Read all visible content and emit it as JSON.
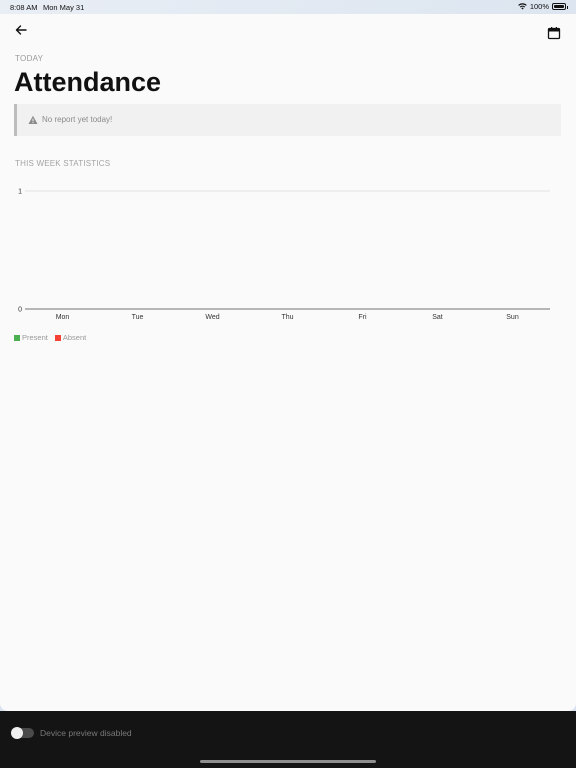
{
  "status_bar": {
    "time": "8:08 AM",
    "date": "Mon May 31",
    "battery": "100%",
    "icons": [
      "wifi-icon",
      "battery-icon"
    ]
  },
  "header": {
    "back_icon": "arrow-left-icon",
    "calendar_icon": "calendar-icon"
  },
  "page": {
    "today_label": "TODAY",
    "title": "Attendance",
    "alert": {
      "icon": "warning-icon",
      "text": "No report yet today!"
    },
    "section_label": "THIS WEEK STATISTICS"
  },
  "chart_data": {
    "type": "bar",
    "categories": [
      "Mon",
      "Tue",
      "Wed",
      "Thu",
      "Fri",
      "Sat",
      "Sun"
    ],
    "series": [
      {
        "name": "Present",
        "values": [
          0,
          0,
          0,
          0,
          0,
          0,
          0
        ],
        "color": "#4caf50"
      },
      {
        "name": "Absent",
        "values": [
          0,
          0,
          0,
          0,
          0,
          0,
          0
        ],
        "color": "#f44336"
      }
    ],
    "ylim": [
      0,
      1
    ],
    "yticks": [
      "0",
      "1"
    ],
    "grid": true,
    "legend": "bottom-left"
  },
  "footer": {
    "device_preview_label": "Device preview disabled",
    "toggle_on": false
  }
}
